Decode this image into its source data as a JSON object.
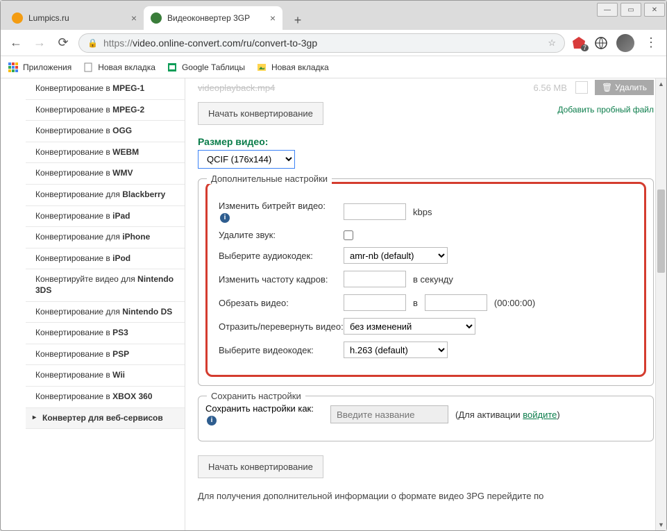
{
  "window": {
    "tabs": [
      {
        "title": "Lumpics.ru",
        "favicon_color": "#f39c12"
      },
      {
        "title": "Видеоконвертер 3GP",
        "favicon_color": "#3a7d3a"
      }
    ],
    "url_protocol": "https://",
    "url_rest": "video.online-convert.com/ru/convert-to-3gp",
    "adblock_badge": "7"
  },
  "bookmarks": {
    "apps": "Приложения",
    "new_tab1": "Новая вкладка",
    "google_sheets": "Google Таблицы",
    "new_tab2": "Новая вкладка"
  },
  "sidebar": {
    "items": [
      {
        "prefix": "Конвертирование в ",
        "bold": "MPEG-1"
      },
      {
        "prefix": "Конвертирование в ",
        "bold": "MPEG-2"
      },
      {
        "prefix": "Конвертирование в ",
        "bold": "OGG"
      },
      {
        "prefix": "Конвертирование в ",
        "bold": "WEBM"
      },
      {
        "prefix": "Конвертирование в ",
        "bold": "WMV"
      },
      {
        "prefix": "Конвертирование для ",
        "bold": "Blackberry"
      },
      {
        "prefix": "Конвертирование в ",
        "bold": "iPad"
      },
      {
        "prefix": "Конвертирование для ",
        "bold": "iPhone"
      },
      {
        "prefix": "Конвертирование в ",
        "bold": "iPod"
      },
      {
        "prefix": "Конвертируйте видео для ",
        "bold": "Nintendo 3DS"
      },
      {
        "prefix": "Конвертирование для ",
        "bold": "Nintendo DS"
      },
      {
        "prefix": "Конвертирование в ",
        "bold": "PS3"
      },
      {
        "prefix": "Конвертирование в ",
        "bold": "PSP"
      },
      {
        "prefix": "Конвертирование в ",
        "bold": "Wii"
      },
      {
        "prefix": "Конвертирование в ",
        "bold": "XBOX 360"
      }
    ],
    "expandable": "Конвертер для веб-сервисов"
  },
  "file": {
    "name": "videoplayback.mp4",
    "size": "6.56 MB",
    "delete_label": "Удалить"
  },
  "convert_btn": "Начать конвертирование",
  "trial_link": "Добавить пробный файл",
  "size_label": "Размер видео:",
  "size_selected": "QCIF (176x144)",
  "fieldset_advanced": "Дополнительные настройки",
  "settings": {
    "bitrate_label": "Изменить битрейт видео:",
    "bitrate_unit": "kbps",
    "remove_audio_label": "Удалите звук:",
    "audio_codec_label": "Выберите аудиокодек:",
    "audio_codec_value": "amr-nb (default)",
    "framerate_label": "Изменить частоту кадров:",
    "framerate_unit": "в секунду",
    "trim_label": "Обрезать видео:",
    "trim_sep": "в",
    "trim_hint": "(00:00:00)",
    "flip_label": "Отразить/перевернуть видео:",
    "flip_value": "без изменений",
    "video_codec_label": "Выберите видеокодек:",
    "video_codec_value": "h.263 (default)"
  },
  "fieldset_save": "Сохранить настройки",
  "save": {
    "label": "Сохранить настройки как:",
    "placeholder": "Введите название",
    "activation_prefix": "(Для активации ",
    "activation_link": "войдите",
    "activation_suffix": ")"
  },
  "convert_btn2": "Начать конвертирование",
  "footer_text": "Для получения дополнительной информации о формате видео 3PG перейдите по"
}
